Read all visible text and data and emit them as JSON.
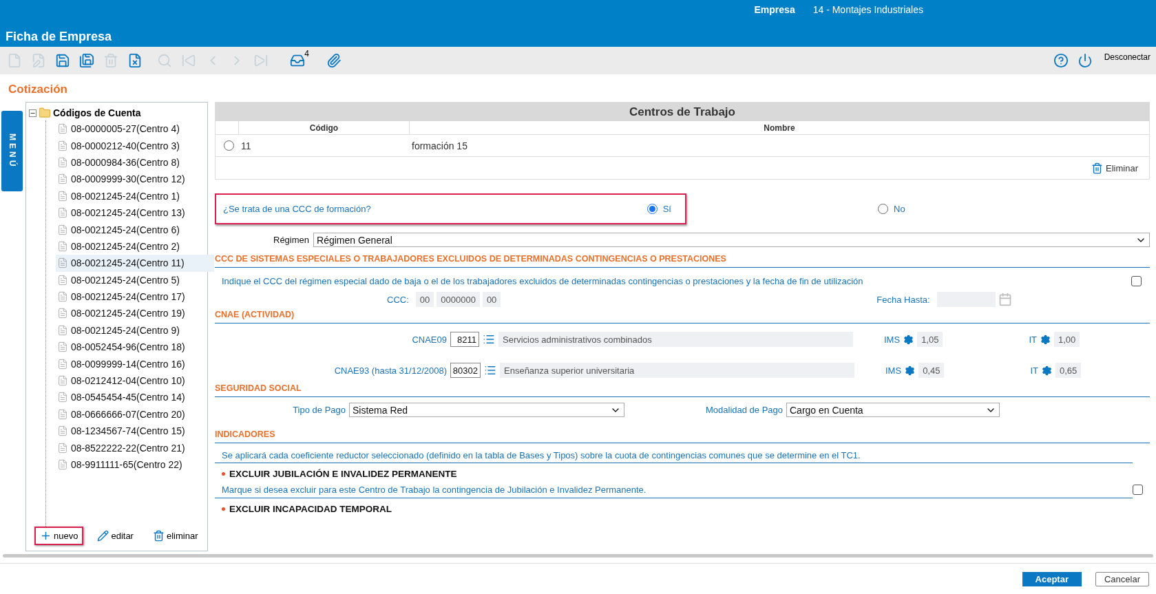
{
  "header": {
    "app_label": "Empresa",
    "company": "14 - Montajes Industriales",
    "title": "Ficha de Empresa"
  },
  "toolbar": {
    "buttons": [
      {
        "disabled": true
      },
      {
        "disabled": true
      },
      {
        "disabled": false
      },
      {
        "disabled": false
      },
      {
        "disabled": true
      },
      {
        "disabled": false
      },
      {
        "disabled": true
      },
      {
        "disabled": true
      },
      {
        "disabled": true
      },
      {
        "disabled": true
      },
      {
        "disabled": true
      },
      {
        "disabled": false,
        "badge": "4"
      },
      {
        "disabled": false
      }
    ],
    "logout": "Desconectar"
  },
  "section_title": "Cotización",
  "menu_tab": "MENÚ",
  "tree": {
    "root": "Códigos de Cuenta",
    "expanded": true,
    "children": [
      {
        "label": "08-0000005-27(Centro 4)",
        "selected": false
      },
      {
        "label": "08-0000212-40(Centro 3)",
        "selected": false
      },
      {
        "label": "08-0000984-36(Centro 8)",
        "selected": false
      },
      {
        "label": "08-0009999-30(Centro 12)",
        "selected": false
      },
      {
        "label": "08-0021245-24(Centro 1)",
        "selected": false
      },
      {
        "label": "08-0021245-24(Centro 13)",
        "selected": false
      },
      {
        "label": "08-0021245-24(Centro 6)",
        "selected": false
      },
      {
        "label": "08-0021245-24(Centro 2)",
        "selected": false
      },
      {
        "label": "08-0021245-24(Centro 11)",
        "selected": true
      },
      {
        "label": "08-0021245-24(Centro 5)",
        "selected": false
      },
      {
        "label": "08-0021245-24(Centro 17)",
        "selected": false
      },
      {
        "label": "08-0021245-24(Centro 19)",
        "selected": false
      },
      {
        "label": "08-0021245-24(Centro 9)",
        "selected": false
      },
      {
        "label": "08-0052454-96(Centro 18)",
        "selected": false
      },
      {
        "label": "08-0099999-14(Centro 16)",
        "selected": false
      },
      {
        "label": "08-0212412-04(Centro 10)",
        "selected": false
      },
      {
        "label": "08-0545454-45(Centro 14)",
        "selected": false
      },
      {
        "label": "08-0666666-07(Centro 20)",
        "selected": false
      },
      {
        "label": "08-1234567-74(Centro 15)",
        "selected": false
      },
      {
        "label": "08-8522222-22(Centro 21)",
        "selected": false
      },
      {
        "label": "08-9911111-65(Centro 22)",
        "selected": false
      }
    ]
  },
  "tree_actions": [
    {
      "label": "nuevo",
      "highlighted": true
    },
    {
      "label": "editar",
      "highlighted": false
    },
    {
      "label": "eliminar",
      "highlighted": false
    }
  ],
  "centros": {
    "title": "Centros de Trabajo",
    "columns": [
      "Código",
      "Nombre"
    ],
    "rows": [
      {
        "selected": false,
        "codigo": "11",
        "nombre": "formación 15"
      }
    ],
    "delete": "Eliminar"
  },
  "formacion": {
    "question": "¿Se trata de una CCC de formación?",
    "highlighted": true,
    "options": [
      {
        "label": "Sí",
        "selected": true
      },
      {
        "label": "No",
        "selected": false
      }
    ]
  },
  "regimen": {
    "label": "Régimen",
    "value": "Régimen General"
  },
  "especiales": {
    "heading": "CCC DE SISTEMAS ESPECIALES O TRABAJADORES EXCLUIDOS DE DETERMINADAS CONTINGENCIAS O PRESTACIONES",
    "text": "Indique el CCC del régimen especial dado de baja o el de los trabajadores excluidos de determinadas contingencias o prestaciones y la fecha de fin de utilización",
    "checked": false,
    "ccc_label": "CCC:",
    "ccc": [
      "00",
      "0000000",
      "00"
    ],
    "fecha_label": "Fecha Hasta:"
  },
  "cnae": {
    "heading": "CNAE (ACTIVIDAD)",
    "rows": [
      {
        "label": "CNAE09",
        "code": "8211",
        "description": "Servicios administrativos combinados",
        "ims_label": "IMS",
        "ims": "1,05",
        "it_label": "IT",
        "it": "1,00"
      },
      {
        "label": "CNAE93 (hasta 31/12/2008)",
        "code": "80302",
        "description": "Enseñanza superior universitaria",
        "ims_label": "IMS",
        "ims": "0,45",
        "it_label": "IT",
        "it": "0,65"
      }
    ]
  },
  "seguridad": {
    "heading": "SEGURIDAD SOCIAL",
    "tipo_label": "Tipo de Pago",
    "tipo": "Sistema Red",
    "modalidad_label": "Modalidad de Pago",
    "modalidad": "Cargo en Cuenta"
  },
  "indicadores": {
    "heading": "INDICADORES",
    "note": "Se aplicará cada coeficiente reductor seleccionado (definido en la tabla de Bases y Tipos) sobre la cuota de contingencias comunes que se determine en el TC1.",
    "items": [
      {
        "title": "EXCLUIR JUBILACIÓN E INVALIDEZ PERMANENTE",
        "text": "Marque si desea excluir para este Centro de Trabajo la contingencia de Jubilación e Invalidez Permanente.",
        "checked": false
      },
      {
        "title": "EXCLUIR INCAPACIDAD TEMPORAL"
      }
    ]
  },
  "footer": {
    "accept": "Aceptar",
    "cancel": "Cancelar"
  }
}
